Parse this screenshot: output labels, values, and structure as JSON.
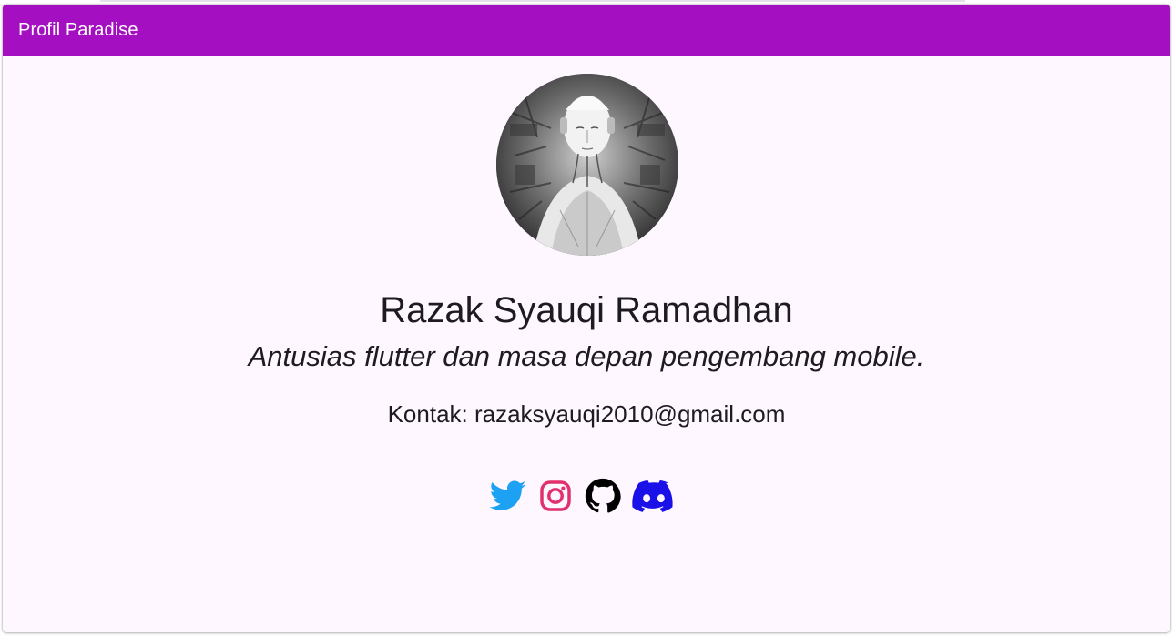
{
  "app_bar": {
    "title": "Profil Paradise",
    "color": "#a40fc2"
  },
  "profile": {
    "avatar_icon": "profile-avatar-image",
    "name": "Razak Syauqi Ramadhan",
    "tagline": "Antusias flutter dan masa depan pengembang mobile.",
    "contact": "Kontak: razaksyauqi2010@gmail.com"
  },
  "socials": [
    {
      "icon": "twitter-icon",
      "color": "#1da1f2"
    },
    {
      "icon": "instagram-icon",
      "color": "#e1306c"
    },
    {
      "icon": "github-icon",
      "color": "#000000"
    },
    {
      "icon": "discord-icon",
      "color": "#1a10e8"
    }
  ],
  "colors": {
    "background": "#fef7ff",
    "text": "#1d1b20"
  }
}
